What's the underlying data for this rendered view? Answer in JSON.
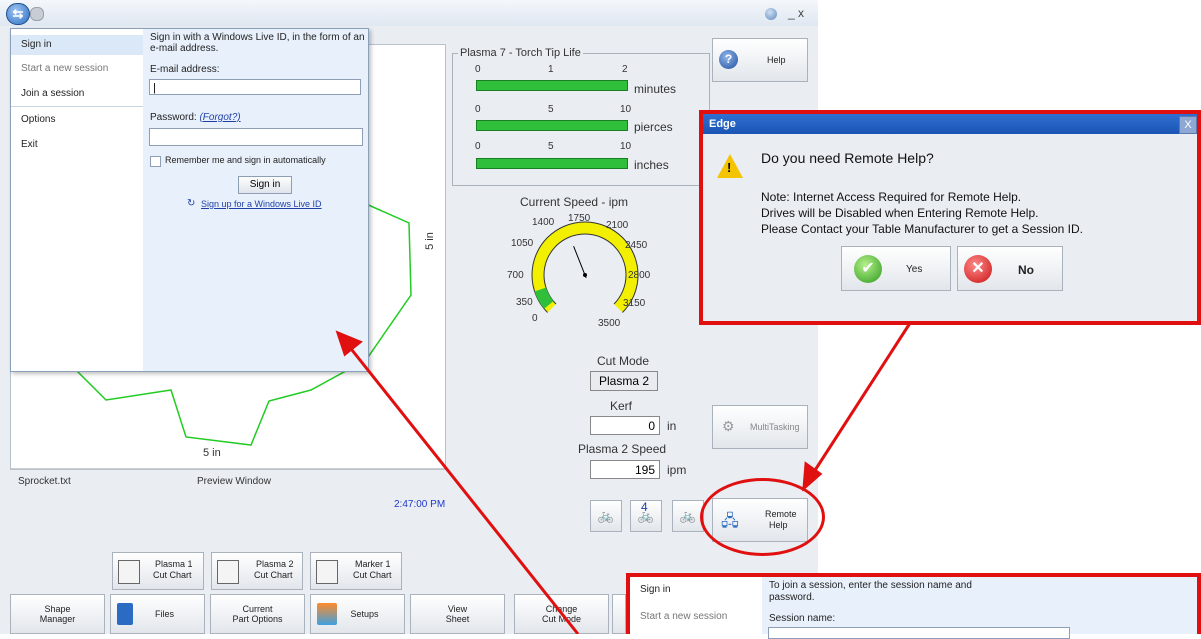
{
  "titlebar": {
    "controls": "_ x"
  },
  "signin": {
    "nav": [
      "Sign in",
      "Start a new session",
      "Join a session",
      "Options",
      "Exit"
    ],
    "intro_line1": "Sign in with a Windows Live ID, in the form of an",
    "intro_line2": "e-mail address.",
    "email_label": "E-mail address:",
    "email_value": "|",
    "password_label": "Password:",
    "forgot_link": "(Forgot?)",
    "remember": "Remember me and sign in automatically",
    "signin_button": "Sign in",
    "signup_link": "Sign up for a Windows Live ID"
  },
  "preview": {
    "side_label": "5 in",
    "bottom_label": "5 in",
    "file_name": "Sprocket.txt",
    "window_label": "Preview Window",
    "time": "2:47:00 PM"
  },
  "torch_life": {
    "title": "Plasma 7 - Torch Tip Life",
    "bars": [
      {
        "scale": [
          "0",
          "1",
          "2"
        ],
        "unit": "minutes"
      },
      {
        "scale": [
          "0",
          "5",
          "10"
        ],
        "unit": "pierces"
      },
      {
        "scale": [
          "0",
          "5",
          "10"
        ],
        "unit": "inches"
      }
    ]
  },
  "speed": {
    "title": "Current Speed - ipm",
    "ticks": [
      "0",
      "350",
      "700",
      "1050",
      "1400",
      "1750",
      "2100",
      "2450",
      "2800",
      "3150",
      "3500"
    ],
    "value_fraction": 0.1
  },
  "cut": {
    "mode_label": "Cut Mode",
    "mode_value": "Plasma 2",
    "kerf_label": "Kerf",
    "kerf_value": "0",
    "kerf_unit": "in",
    "speed_label": "Plasma 2 Speed",
    "speed_value": "195",
    "speed_unit": "ipm"
  },
  "right_buttons": {
    "help": "Help",
    "multitasking": "MultiTasking",
    "remote_line1": "Remote",
    "remote_line2": "Help",
    "bike_middle": "4"
  },
  "cut_charts": [
    {
      "line1": "Plasma 1",
      "line2": "Cut Chart"
    },
    {
      "line1": "Plasma 2",
      "line2": "Cut Chart"
    },
    {
      "line1": "Marker 1",
      "line2": "Cut Chart"
    }
  ],
  "bottom_bar": [
    {
      "line1": "Shape",
      "line2": "Manager"
    },
    {
      "line1": "Files",
      "line2": ""
    },
    {
      "line1": "Current",
      "line2": "Part Options"
    },
    {
      "line1": "Setups",
      "line2": ""
    },
    {
      "line1": "View",
      "line2": "Sheet"
    },
    {
      "line1": "Change",
      "line2": "Cut Mode"
    }
  ],
  "edge_dialog": {
    "title": "Edge",
    "close": "X",
    "question": "Do you need Remote Help?",
    "notes": [
      "Note: Internet Access Required for Remote Help.",
      "Drives will be Disabled when Entering Remote Help.",
      "Please Contact your Table Manufacturer to get a Session ID."
    ],
    "yes": "Yes",
    "no": "No"
  },
  "join_panel": {
    "nav": [
      "Sign in",
      "Start a new session"
    ],
    "intro_line1": "To join a session, enter the session name and",
    "intro_line2": "password.",
    "session_label": "Session name:"
  },
  "colors": {
    "highlight": "#e01010",
    "gear": "#22cc22",
    "gauge_fill": "#f2f000",
    "bar": "#2fbf3a",
    "dialog_title": "#1b55b4"
  }
}
